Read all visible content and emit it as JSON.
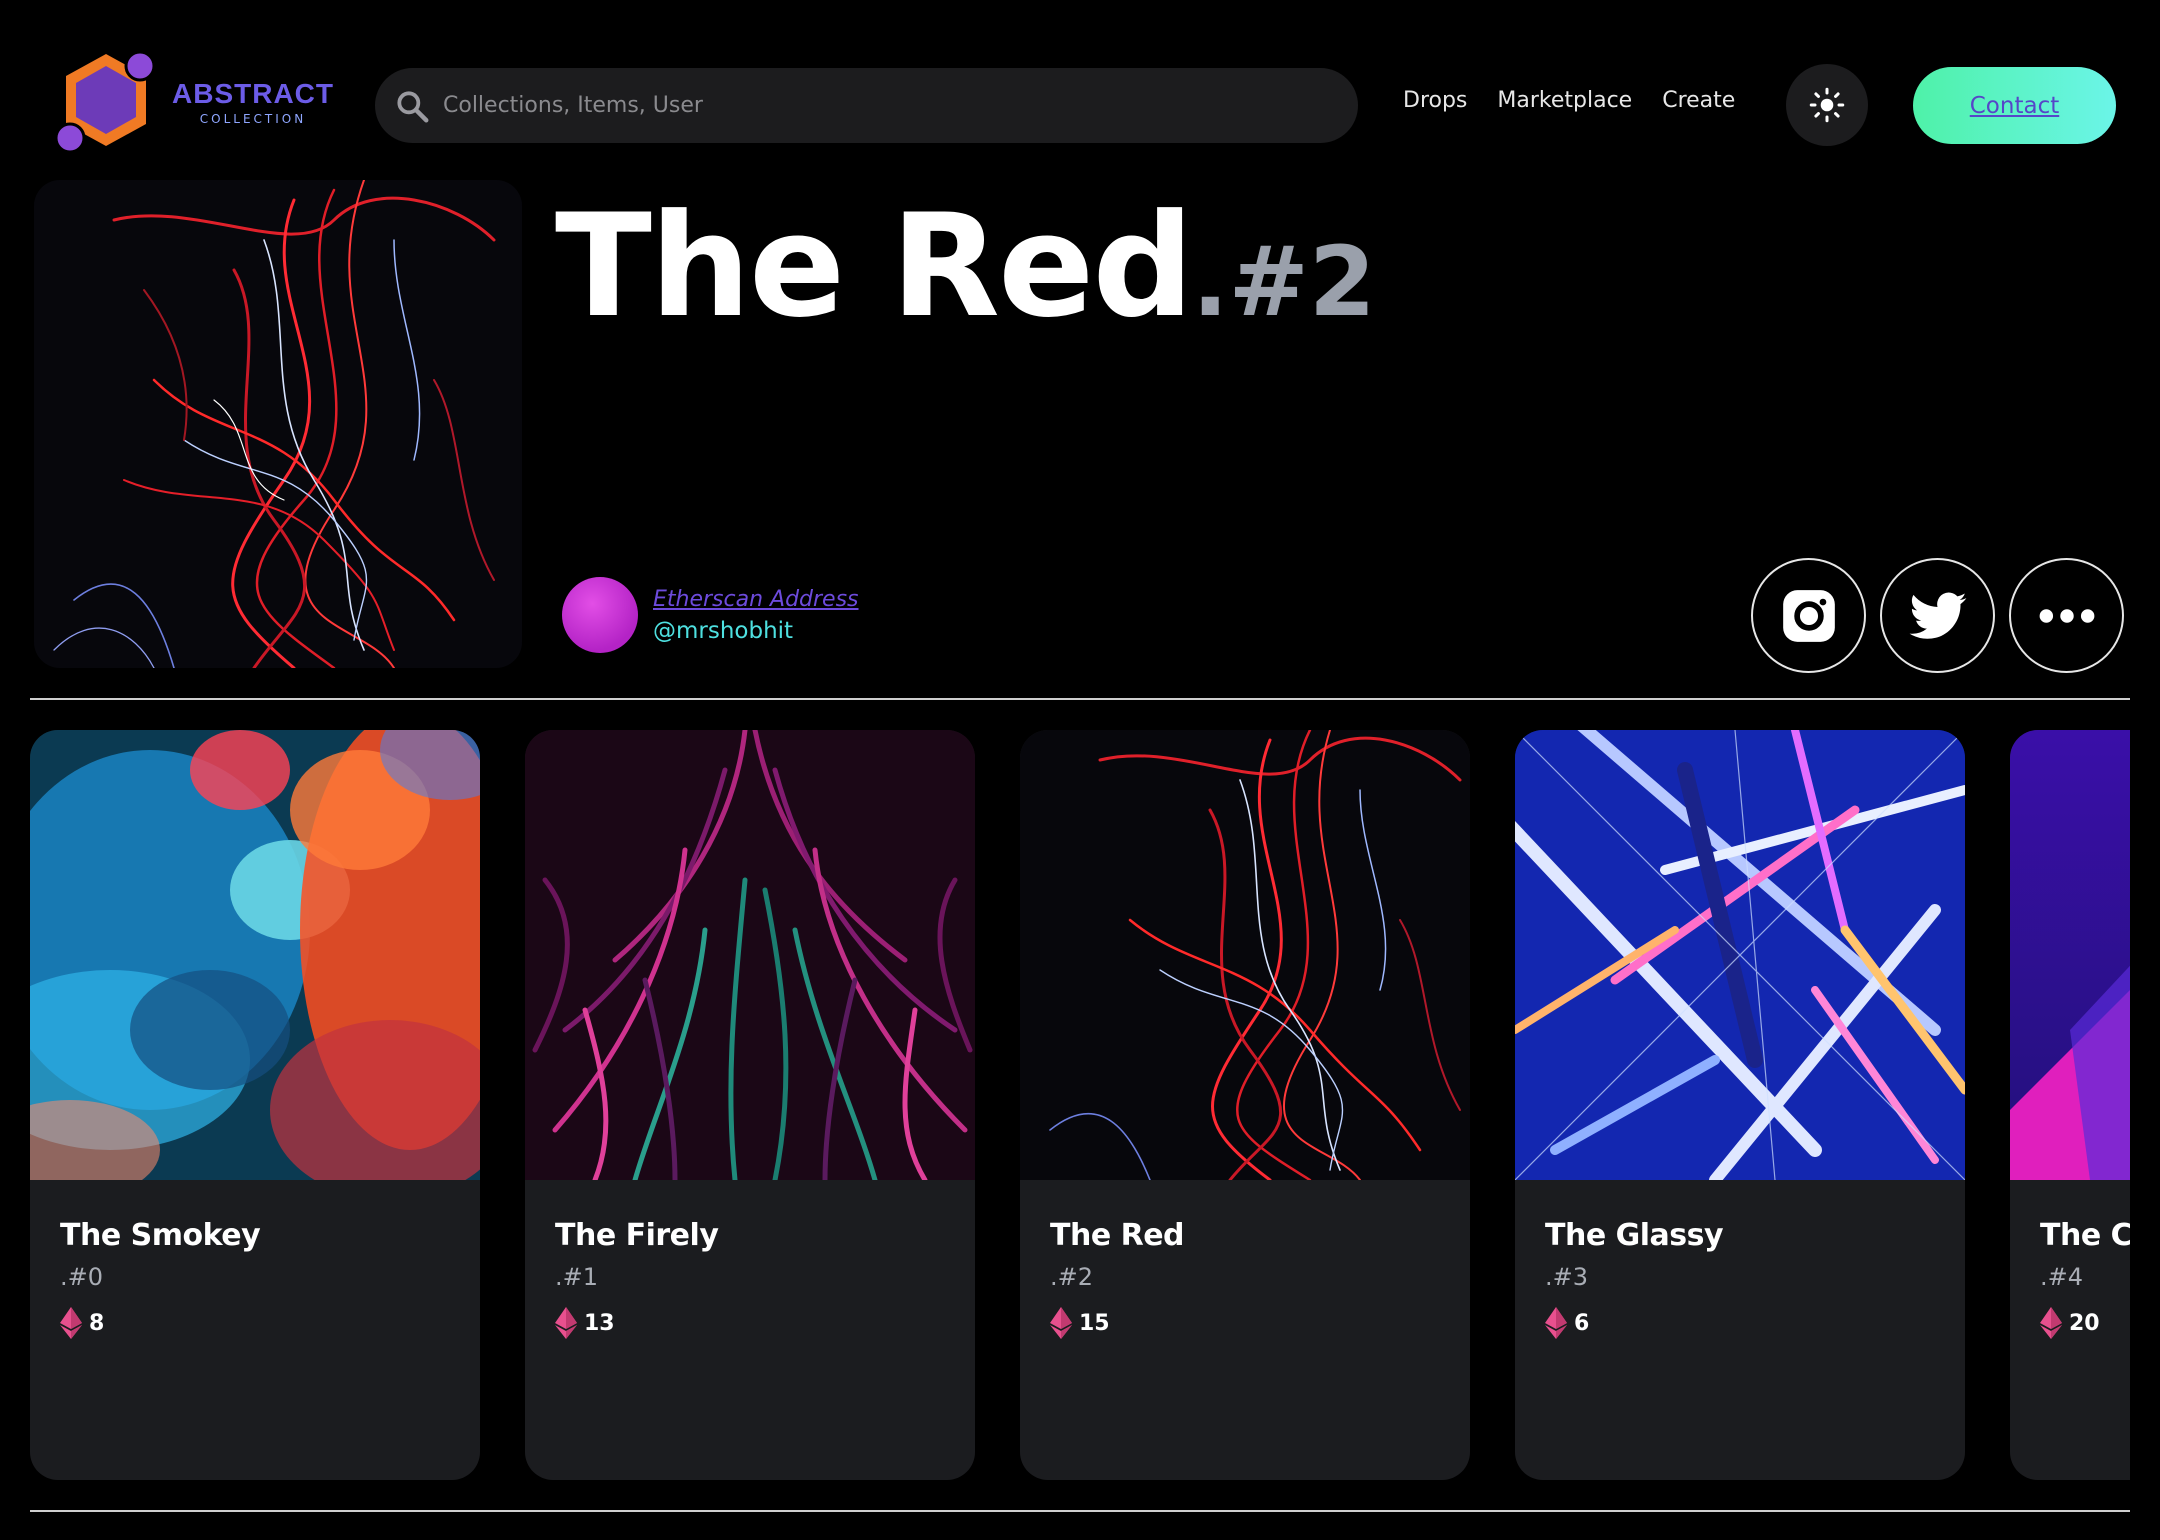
{
  "header": {
    "logo_title": "ABSTRACT",
    "logo_subtitle": "COLLECTION",
    "search_placeholder": "Collections, Items, User",
    "nav": [
      "Drops",
      "Marketplace",
      "Create"
    ],
    "theme_icon": "sun-icon",
    "contact_label": "Contact"
  },
  "hero": {
    "title": "The Red",
    "number": ".#2",
    "creator_link": "Etherscan Address",
    "creator_handle": "@mrshobhit",
    "social_icons": [
      "instagram-icon",
      "twitter-icon",
      "more-icon"
    ]
  },
  "cards": [
    {
      "title": "The Smokey",
      "number": ".#0",
      "price": "8",
      "art": "smoke"
    },
    {
      "title": "The Firely",
      "number": ".#1",
      "price": "13",
      "art": "fur"
    },
    {
      "title": "The Red",
      "number": ".#2",
      "price": "15",
      "art": "red-lights"
    },
    {
      "title": "The Glassy",
      "number": ".#3",
      "price": "6",
      "art": "neon-cube"
    },
    {
      "title": "The Cl",
      "number": ".#4",
      "price": "20",
      "art": "purple-geometric"
    }
  ],
  "colors": {
    "background": "#000000",
    "accent_gradient_start": "#4ef2a8",
    "accent_gradient_end": "#6bf4e8",
    "logo_purple": "#6c5ce7",
    "logo_orange": "#f07a24",
    "handle_cyan": "#4ee0e0",
    "card_background": "#1b1c1f",
    "eth_pink": "#e8508e"
  }
}
